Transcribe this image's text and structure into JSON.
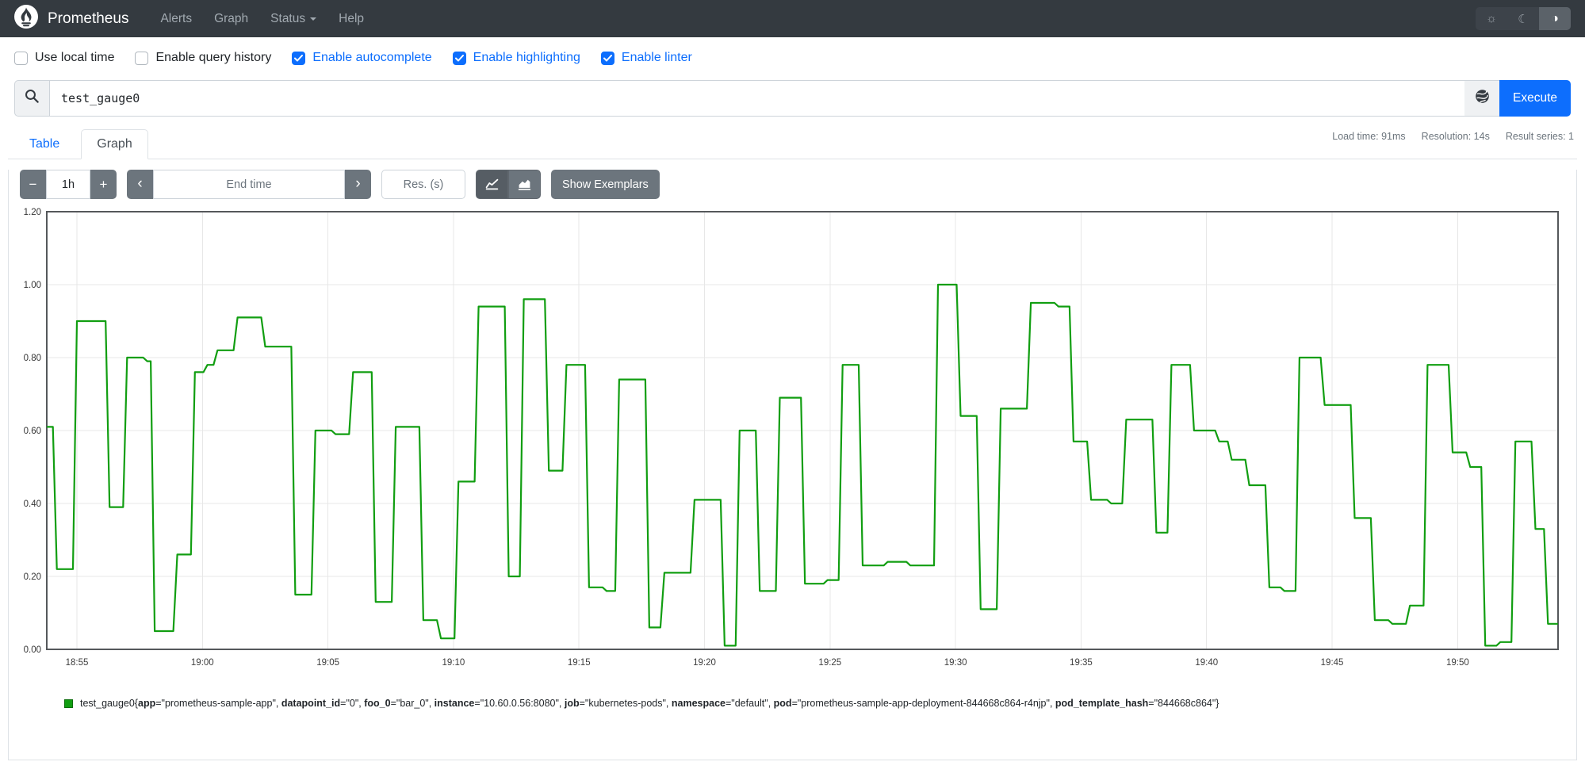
{
  "navbar": {
    "brand": "Prometheus",
    "items": [
      {
        "label": "Alerts",
        "has_caret": false
      },
      {
        "label": "Graph",
        "has_caret": false
      },
      {
        "label": "Status",
        "has_caret": true
      },
      {
        "label": "Help",
        "has_caret": false
      }
    ],
    "theme_toggle": {
      "options": [
        {
          "name": "light",
          "icon": "☼"
        },
        {
          "name": "dark",
          "icon": "☾"
        },
        {
          "name": "auto",
          "icon": "◑"
        }
      ],
      "active": "auto"
    }
  },
  "options": {
    "checkboxes": [
      {
        "label": "Use local time",
        "checked": false
      },
      {
        "label": "Enable query history",
        "checked": false
      },
      {
        "label": "Enable autocomplete",
        "checked": true
      },
      {
        "label": "Enable highlighting",
        "checked": true
      },
      {
        "label": "Enable linter",
        "checked": true
      }
    ]
  },
  "query": {
    "value": "test_gauge0",
    "execute_label": "Execute"
  },
  "stats": {
    "load_time": "Load time: 91ms",
    "resolution": "Resolution: 14s",
    "result_series": "Result series: 1"
  },
  "tabs": [
    {
      "label": "Table",
      "active": false
    },
    {
      "label": "Graph",
      "active": true
    }
  ],
  "graph_controls": {
    "minus_label": "−",
    "plus_label": "+",
    "range_value": "1h",
    "prev_label": "‹",
    "next_label": "›",
    "end_time_placeholder": "End time",
    "res_placeholder": "Res. (s)",
    "show_exemplars_label": "Show Exemplars"
  },
  "colors": {
    "accent_blue": "#0d6efd",
    "navbar_bg": "#343a40",
    "button_gray": "#6c757d",
    "series_green": "#119e11",
    "grid_gray": "#e7e7e7",
    "frame_gray": "#55585b"
  },
  "chart_data": {
    "type": "line",
    "line_style": "step-after",
    "title": "",
    "xlabel": "",
    "ylabel": "",
    "grid": true,
    "legend_position": "bottom",
    "ylim": [
      0,
      1.2
    ],
    "y_tick_step": 0.2,
    "xlim_minutes": [
      1133.8,
      1194.0
    ],
    "x_ticks": [
      {
        "t": 1135,
        "label": "18:55"
      },
      {
        "t": 1140,
        "label": "19:00"
      },
      {
        "t": 1145,
        "label": "19:05"
      },
      {
        "t": 1150,
        "label": "19:10"
      },
      {
        "t": 1155,
        "label": "19:15"
      },
      {
        "t": 1160,
        "label": "19:20"
      },
      {
        "t": 1165,
        "label": "19:25"
      },
      {
        "t": 1170,
        "label": "19:30"
      },
      {
        "t": 1175,
        "label": "19:35"
      },
      {
        "t": 1180,
        "label": "19:40"
      },
      {
        "t": 1185,
        "label": "19:45"
      },
      {
        "t": 1190,
        "label": "19:50"
      }
    ],
    "series": [
      {
        "name": "test_gauge0",
        "color": "#119e11",
        "points": [
          [
            1133.8,
            0.61
          ],
          [
            1134.2,
            0.22
          ],
          [
            1135.0,
            0.9
          ],
          [
            1136.3,
            0.39
          ],
          [
            1137.0,
            0.8
          ],
          [
            1137.8,
            0.79
          ],
          [
            1138.1,
            0.05
          ],
          [
            1139.0,
            0.26
          ],
          [
            1139.7,
            0.76
          ],
          [
            1140.2,
            0.78
          ],
          [
            1140.6,
            0.82
          ],
          [
            1141.4,
            0.91
          ],
          [
            1142.5,
            0.83
          ],
          [
            1143.7,
            0.15
          ],
          [
            1144.5,
            0.6
          ],
          [
            1145.3,
            0.59
          ],
          [
            1146.0,
            0.76
          ],
          [
            1146.9,
            0.13
          ],
          [
            1147.7,
            0.61
          ],
          [
            1148.8,
            0.08
          ],
          [
            1149.5,
            0.03
          ],
          [
            1150.2,
            0.46
          ],
          [
            1151.0,
            0.94
          ],
          [
            1152.2,
            0.2
          ],
          [
            1152.8,
            0.96
          ],
          [
            1153.8,
            0.49
          ],
          [
            1154.5,
            0.78
          ],
          [
            1155.4,
            0.17
          ],
          [
            1156.1,
            0.16
          ],
          [
            1156.6,
            0.74
          ],
          [
            1157.8,
            0.06
          ],
          [
            1158.4,
            0.21
          ],
          [
            1159.6,
            0.41
          ],
          [
            1160.8,
            0.01
          ],
          [
            1161.4,
            0.6
          ],
          [
            1162.2,
            0.16
          ],
          [
            1163.0,
            0.69
          ],
          [
            1164.0,
            0.18
          ],
          [
            1164.9,
            0.19
          ],
          [
            1165.5,
            0.78
          ],
          [
            1166.3,
            0.23
          ],
          [
            1167.3,
            0.24
          ],
          [
            1168.2,
            0.23
          ],
          [
            1169.3,
            1.0
          ],
          [
            1170.2,
            0.64
          ],
          [
            1171.0,
            0.11
          ],
          [
            1171.8,
            0.66
          ],
          [
            1173.0,
            0.95
          ],
          [
            1174.1,
            0.94
          ],
          [
            1174.7,
            0.57
          ],
          [
            1175.4,
            0.41
          ],
          [
            1176.2,
            0.4
          ],
          [
            1176.8,
            0.63
          ],
          [
            1178.0,
            0.32
          ],
          [
            1178.6,
            0.78
          ],
          [
            1179.5,
            0.6
          ],
          [
            1180.5,
            0.57
          ],
          [
            1181.0,
            0.52
          ],
          [
            1181.7,
            0.45
          ],
          [
            1182.5,
            0.17
          ],
          [
            1183.1,
            0.16
          ],
          [
            1183.7,
            0.8
          ],
          [
            1184.7,
            0.67
          ],
          [
            1185.9,
            0.36
          ],
          [
            1186.7,
            0.08
          ],
          [
            1187.4,
            0.07
          ],
          [
            1188.1,
            0.12
          ],
          [
            1188.8,
            0.78
          ],
          [
            1189.8,
            0.54
          ],
          [
            1190.5,
            0.5
          ],
          [
            1191.1,
            0.01
          ],
          [
            1191.7,
            0.02
          ],
          [
            1192.3,
            0.57
          ],
          [
            1193.1,
            0.33
          ],
          [
            1193.6,
            0.07
          ],
          [
            1194.0,
            0.07
          ]
        ]
      }
    ]
  },
  "legend": {
    "metric": "test_gauge0",
    "labels": [
      {
        "k": "app",
        "v": "prometheus-sample-app"
      },
      {
        "k": "datapoint_id",
        "v": "0"
      },
      {
        "k": "foo_0",
        "v": "bar_0"
      },
      {
        "k": "instance",
        "v": "10.60.0.56:8080"
      },
      {
        "k": "job",
        "v": "kubernetes-pods"
      },
      {
        "k": "namespace",
        "v": "default"
      },
      {
        "k": "pod",
        "v": "prometheus-sample-app-deployment-844668c864-r4njp"
      },
      {
        "k": "pod_template_hash",
        "v": "844668c864"
      }
    ]
  }
}
